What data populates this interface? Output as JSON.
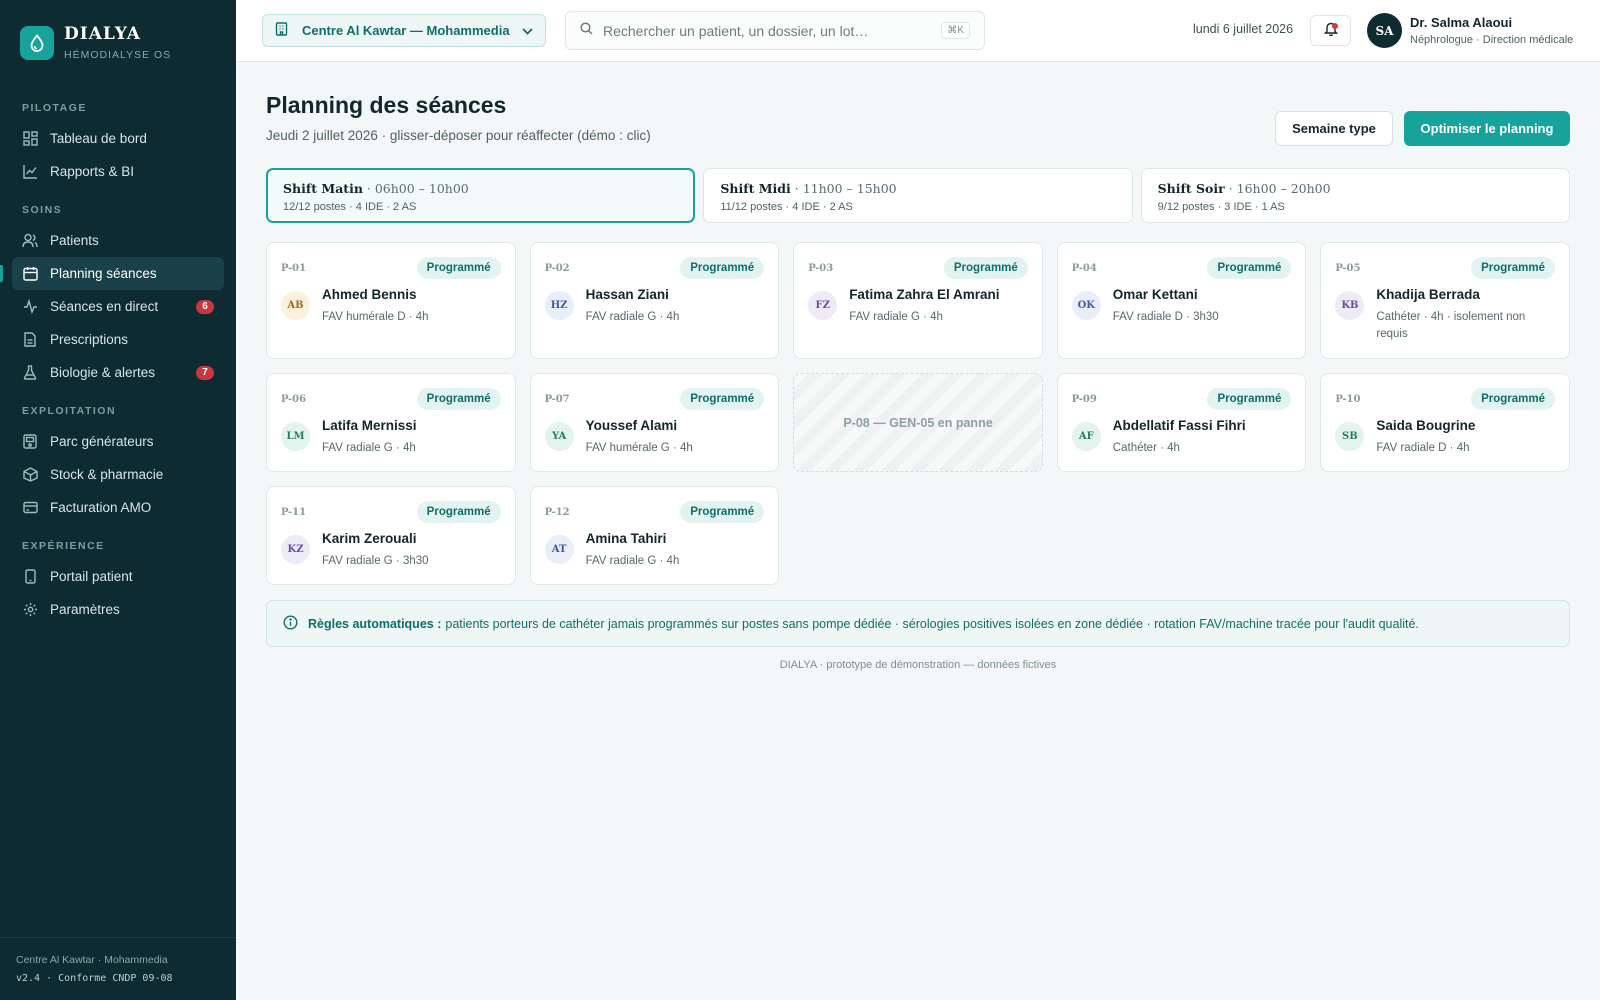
{
  "brand": {
    "name": "DIALYA",
    "subtitle": "HÉMODIALYSE OS",
    "logo_icon": "drop-icon",
    "accent": "#17a39b"
  },
  "sidebar": {
    "sections": [
      {
        "title": "PILOTAGE",
        "items": [
          {
            "label": "Tableau de bord",
            "icon": "dashboard-icon"
          },
          {
            "label": "Rapports & BI",
            "icon": "chart-line-icon"
          }
        ]
      },
      {
        "title": "SOINS",
        "items": [
          {
            "label": "Patients",
            "icon": "users-icon"
          },
          {
            "label": "Planning séances",
            "icon": "calendar-icon",
            "active": true
          },
          {
            "label": "Séances en direct",
            "icon": "activity-icon",
            "badge": "6"
          },
          {
            "label": "Prescriptions",
            "icon": "document-icon"
          },
          {
            "label": "Biologie & alertes",
            "icon": "flask-icon",
            "badge": "7"
          }
        ]
      },
      {
        "title": "EXPLOITATION",
        "items": [
          {
            "label": "Parc générateurs",
            "icon": "machine-icon"
          },
          {
            "label": "Stock & pharmacie",
            "icon": "box-icon"
          },
          {
            "label": "Facturation AMO",
            "icon": "credit-card-icon"
          }
        ]
      },
      {
        "title": "EXPÉRIENCE",
        "items": [
          {
            "label": "Portail patient",
            "icon": "smartphone-icon"
          },
          {
            "label": "Paramètres",
            "icon": "gear-icon"
          }
        ]
      }
    ],
    "footer": {
      "center": "Centre Al Kawtar · Mohammedia",
      "version": "v2.4 · Conforme CNDP 09-08"
    }
  },
  "header": {
    "center_select": "Centre Al Kawtar — Mohammedia",
    "search_placeholder": "Rechercher un patient, un dossier, un lot…",
    "search_shortcut": "⌘K",
    "date": "lundi 6 juillet 2026",
    "user": {
      "initials": "SA",
      "name": "Dr. Salma Alaoui",
      "role": "Néphrologue · Direction médicale"
    }
  },
  "page": {
    "title": "Planning des séances",
    "subtitle": "Jeudi 2 juillet 2026 · glisser-déposer pour réaffecter (démo : clic)",
    "btn_template": "Semaine type",
    "btn_optimize": "Optimiser le planning"
  },
  "shifts": [
    {
      "name": "Shift Matin",
      "time": "06h00 – 10h00",
      "stats": "12/12 postes · 4 IDE · 2 AS",
      "active": true
    },
    {
      "name": "Shift Midi",
      "time": "11h00 – 15h00",
      "stats": "11/12 postes · 4 IDE · 2 AS"
    },
    {
      "name": "Shift Soir",
      "time": "16h00 – 20h00",
      "stats": "9/12 postes · 3 IDE · 1 AS"
    }
  ],
  "stations": [
    {
      "post": "P-01",
      "status": "Programmé",
      "initials": "AB",
      "avatar": "orange",
      "name": "Ahmed Bennis",
      "detail": "FAV humérale D · 4h"
    },
    {
      "post": "P-02",
      "status": "Programmé",
      "initials": "HZ",
      "avatar": "blue",
      "name": "Hassan Ziani",
      "detail": "FAV radiale G · 4h"
    },
    {
      "post": "P-03",
      "status": "Programmé",
      "initials": "FZ",
      "avatar": "purple",
      "name": "Fatima Zahra El Amrani",
      "detail": "FAV radiale G · 4h"
    },
    {
      "post": "P-04",
      "status": "Programmé",
      "initials": "OK",
      "avatar": "blue",
      "name": "Omar Kettani",
      "detail": "FAV radiale D · 3h30"
    },
    {
      "post": "P-05",
      "status": "Programmé",
      "initials": "KB",
      "avatar": "purple",
      "name": "Khadija Berrada",
      "detail": "Cathéter · 4h · isolement non requis"
    },
    {
      "post": "P-06",
      "status": "Programmé",
      "initials": "LM",
      "avatar": "green",
      "name": "Latifa Mernissi",
      "detail": "FAV radiale G · 4h"
    },
    {
      "post": "P-07",
      "status": "Programmé",
      "initials": "YA",
      "avatar": "green",
      "name": "Youssef Alami",
      "detail": "FAV humérale G · 4h"
    },
    {
      "post": "P-08",
      "broken": true,
      "label": "P-08 — GEN-05 en panne"
    },
    {
      "post": "P-09",
      "status": "Programmé",
      "initials": "AF",
      "avatar": "green",
      "name": "Abdellatif Fassi Fihri",
      "detail": "Cathéter · 4h"
    },
    {
      "post": "P-10",
      "status": "Programmé",
      "initials": "SB",
      "avatar": "green",
      "name": "Saida Bougrine",
      "detail": "FAV radiale D · 4h"
    },
    {
      "post": "P-11",
      "status": "Programmé",
      "initials": "KZ",
      "avatar": "purple",
      "name": "Karim Zerouali",
      "detail": "FAV radiale G · 3h30"
    },
    {
      "post": "P-12",
      "status": "Programmé",
      "initials": "AT",
      "avatar": "blue",
      "name": "Amina Tahiri",
      "detail": "FAV radiale G · 4h"
    }
  ],
  "rules": {
    "title": "Règles automatiques :",
    "text": "patients porteurs de cathéter jamais programmés sur postes sans pompe dédiée · sérologies positives isolées en zone dédiée · rotation FAV/machine tracée pour l'audit qualité."
  },
  "footer_note": "DIALYA · prototype de démonstration — données fictives"
}
